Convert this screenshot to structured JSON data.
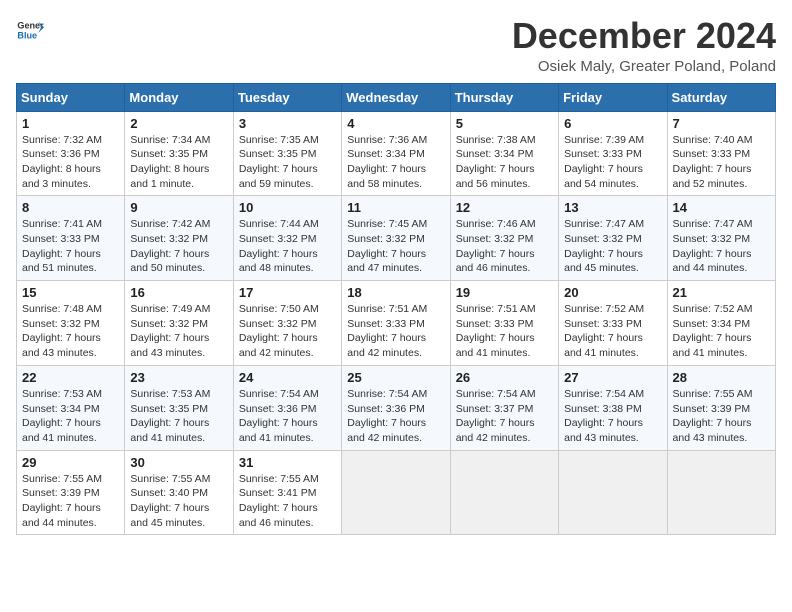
{
  "logo": {
    "line1": "General",
    "line2": "Blue"
  },
  "title": "December 2024",
  "subtitle": "Osiek Maly, Greater Poland, Poland",
  "weekdays": [
    "Sunday",
    "Monday",
    "Tuesday",
    "Wednesday",
    "Thursday",
    "Friday",
    "Saturday"
  ],
  "weeks": [
    [
      {
        "day": "1",
        "sunrise": "7:32 AM",
        "sunset": "3:36 PM",
        "daylight": "8 hours and 3 minutes."
      },
      {
        "day": "2",
        "sunrise": "7:34 AM",
        "sunset": "3:35 PM",
        "daylight": "8 hours and 1 minute."
      },
      {
        "day": "3",
        "sunrise": "7:35 AM",
        "sunset": "3:35 PM",
        "daylight": "7 hours and 59 minutes."
      },
      {
        "day": "4",
        "sunrise": "7:36 AM",
        "sunset": "3:34 PM",
        "daylight": "7 hours and 58 minutes."
      },
      {
        "day": "5",
        "sunrise": "7:38 AM",
        "sunset": "3:34 PM",
        "daylight": "7 hours and 56 minutes."
      },
      {
        "day": "6",
        "sunrise": "7:39 AM",
        "sunset": "3:33 PM",
        "daylight": "7 hours and 54 minutes."
      },
      {
        "day": "7",
        "sunrise": "7:40 AM",
        "sunset": "3:33 PM",
        "daylight": "7 hours and 52 minutes."
      }
    ],
    [
      {
        "day": "8",
        "sunrise": "7:41 AM",
        "sunset": "3:33 PM",
        "daylight": "7 hours and 51 minutes."
      },
      {
        "day": "9",
        "sunrise": "7:42 AM",
        "sunset": "3:32 PM",
        "daylight": "7 hours and 50 minutes."
      },
      {
        "day": "10",
        "sunrise": "7:44 AM",
        "sunset": "3:32 PM",
        "daylight": "7 hours and 48 minutes."
      },
      {
        "day": "11",
        "sunrise": "7:45 AM",
        "sunset": "3:32 PM",
        "daylight": "7 hours and 47 minutes."
      },
      {
        "day": "12",
        "sunrise": "7:46 AM",
        "sunset": "3:32 PM",
        "daylight": "7 hours and 46 minutes."
      },
      {
        "day": "13",
        "sunrise": "7:47 AM",
        "sunset": "3:32 PM",
        "daylight": "7 hours and 45 minutes."
      },
      {
        "day": "14",
        "sunrise": "7:47 AM",
        "sunset": "3:32 PM",
        "daylight": "7 hours and 44 minutes."
      }
    ],
    [
      {
        "day": "15",
        "sunrise": "7:48 AM",
        "sunset": "3:32 PM",
        "daylight": "7 hours and 43 minutes."
      },
      {
        "day": "16",
        "sunrise": "7:49 AM",
        "sunset": "3:32 PM",
        "daylight": "7 hours and 43 minutes."
      },
      {
        "day": "17",
        "sunrise": "7:50 AM",
        "sunset": "3:32 PM",
        "daylight": "7 hours and 42 minutes."
      },
      {
        "day": "18",
        "sunrise": "7:51 AM",
        "sunset": "3:33 PM",
        "daylight": "7 hours and 42 minutes."
      },
      {
        "day": "19",
        "sunrise": "7:51 AM",
        "sunset": "3:33 PM",
        "daylight": "7 hours and 41 minutes."
      },
      {
        "day": "20",
        "sunrise": "7:52 AM",
        "sunset": "3:33 PM",
        "daylight": "7 hours and 41 minutes."
      },
      {
        "day": "21",
        "sunrise": "7:52 AM",
        "sunset": "3:34 PM",
        "daylight": "7 hours and 41 minutes."
      }
    ],
    [
      {
        "day": "22",
        "sunrise": "7:53 AM",
        "sunset": "3:34 PM",
        "daylight": "7 hours and 41 minutes."
      },
      {
        "day": "23",
        "sunrise": "7:53 AM",
        "sunset": "3:35 PM",
        "daylight": "7 hours and 41 minutes."
      },
      {
        "day": "24",
        "sunrise": "7:54 AM",
        "sunset": "3:36 PM",
        "daylight": "7 hours and 41 minutes."
      },
      {
        "day": "25",
        "sunrise": "7:54 AM",
        "sunset": "3:36 PM",
        "daylight": "7 hours and 42 minutes."
      },
      {
        "day": "26",
        "sunrise": "7:54 AM",
        "sunset": "3:37 PM",
        "daylight": "7 hours and 42 minutes."
      },
      {
        "day": "27",
        "sunrise": "7:54 AM",
        "sunset": "3:38 PM",
        "daylight": "7 hours and 43 minutes."
      },
      {
        "day": "28",
        "sunrise": "7:55 AM",
        "sunset": "3:39 PM",
        "daylight": "7 hours and 43 minutes."
      }
    ],
    [
      {
        "day": "29",
        "sunrise": "7:55 AM",
        "sunset": "3:39 PM",
        "daylight": "7 hours and 44 minutes."
      },
      {
        "day": "30",
        "sunrise": "7:55 AM",
        "sunset": "3:40 PM",
        "daylight": "7 hours and 45 minutes."
      },
      {
        "day": "31",
        "sunrise": "7:55 AM",
        "sunset": "3:41 PM",
        "daylight": "7 hours and 46 minutes."
      },
      null,
      null,
      null,
      null
    ]
  ],
  "labels": {
    "sunrise": "Sunrise:",
    "sunset": "Sunset:",
    "daylight": "Daylight hours"
  }
}
